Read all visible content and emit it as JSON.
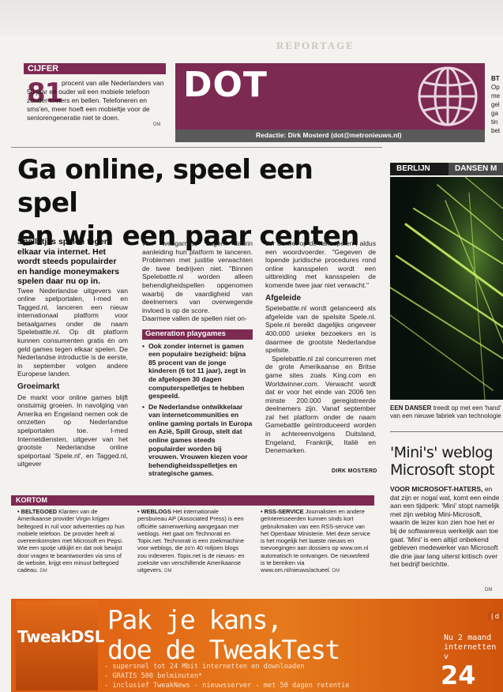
{
  "section_ghost": "REPORTAGE",
  "cijfer": {
    "label": "CIJFER",
    "number": "81",
    "text": "procent van alle Nederlanders van 50 jaar en ouder wil een mobiele telefoon zonder toeters en bellen. Telefoneren en sms'en, meer hoeft een mobieltje voor de seniorengeneratie niet te doen.",
    "sig": "DM"
  },
  "dot": {
    "title": "DOT",
    "redactie": "Redactie: Dirk Mosterd (dot@metronieuws.nl)"
  },
  "side_snippet": {
    "tag": "BT",
    "lines": [
      "Op",
      "me",
      "gel",
      "ga",
      "tin",
      "bet"
    ]
  },
  "article": {
    "headline_line1": "Ga online, speel een spel",
    "headline_line2": "en win een paar centen",
    "intro": "Spelletjes spelen tegen elkaar via internet. Het wordt steeds populairder en handige moneymakers spelen daar nu op in.",
    "p1": "Twee Nederlandse uitgevers van online spelportalen, I-med en Tagged.nl, lanceren een nieuw internationaal platform voor betaalgames onder de naam Spelebattle.nl. Op dit platform kunnen consumenten gratis én om geld games tegen elkaar spelen. De Nederlandse introductie is de eerste, in september volgen andere Europese landen.",
    "sub1": "Groeimarkt",
    "p2": "De markt voor online games blijft onstuimig groeien. In navolging van Amerika en Engeland nemen ook de omzetten op Nederlandse spelportalen toe. I-med Internetdiensten, uitgever van het grootste Nederlandse online spelportaal 'Spele.nl', en Tagged.nl, uitgever",
    "p3": "van webgames, zagen daarin aanleiding hun platform te lanceren. Problemen met justitie verwachten de twee bedrijven niet. \"Binnen Spelebattle.nl worden alleen behendigheidspellen opgenomen waarbij de vaardigheid van deelnemers van overwegende invloed is op de score.",
    "p3b": "Daarmee vallen de spellen niet on-",
    "gen_head": "Generation playgames",
    "gen_1": "Ook zonder internet is gamen een populaire bezigheid: bijna 85 procent van de jonge kinderen (6 tot 11 jaar), zegt in de afgelopen 30 dagen computerspelletjes te hebben gespeeld.",
    "gen_2": "De Nederlandse ontwikkelaar van internetcommunities en online gaming portals in Europa en Azië, Spill Group, stelt dat online games steeds populairder worden bij vrouwen. Vrouwen kiezen voor behendigheidsspelletjes en strategische games.",
    "p4": "der de wet op de kansspelen\", aldus een woordvoerder. \"Gegeven de lopende juridische procedures rond online kansspelen wordt een uitbreiding met kansspelen de komende twee jaar niet verwacht.\"",
    "sub2": "Afgeleide",
    "p5": "Spelebattle.nl wordt gelanceerd als afgeleide van de spelsite Spele.nl. Spele.nl bereikt dagelijks ongeveer 400.000 unieke bezoekers en is daarmee de grootste Nederlandse spelsite.",
    "p6": "Spelebattle.nl zal concurreren met de grote Amerikaanse en Britse game sites zoals King.com en Worldwinner.com. Verwacht wordt dat er voor het einde van 2006 ten minste 200.000 geregistreerde deelnemers zijn. Vanaf september zal het platform onder de naam Gamebattle geïntroduceerd worden in achtereenvolgens Duitsland, Engeland, Frankrijk, Italië en Denemarken.",
    "byline": "DIRK MOSTERD"
  },
  "photo": {
    "label1": "BERLIJN",
    "label2": "DANSEN M",
    "caption_bold": "EEN DANSER",
    "caption": "treedt op met een 'hand' van een nieuwe fabriek van technologie"
  },
  "side_article": {
    "headline": "'Mini's' weblog Microsoft stopt",
    "lead_bold": "VOOR MICROSOFT-HATERS,",
    "text": "en dat zijn er nogal wat, komt een einde aan een tijdperk: 'Mini' stopt namelijk met zijn weblog Mini-Microsoft, waarin de lezer kon zien hoe het er bij de softwarereus werkelijk aan toe gaat. 'Mini' is een altijd onbekend gebleven medewerker van Microsoft die drie jaar lang uiterst kritisch over het bedrijf berichtte.",
    "sig": "DM"
  },
  "kortom": {
    "label": "KORTOM",
    "items": [
      {
        "bold": "• BELTEGOED",
        "text": "Klanten van de Amerikaanse provider Virgin krijgen beltegoed in ruil voor advertenties op hun mobiele telefoon. De provider heeft al overeenkomsten met Microsoft en Pepsi. Wie een spotje uitkijkt en dat ook bewijst door vragen te beantwoorden via sms of de website, krijgt een minuut beltegoed cadeau.",
        "sig": "DM"
      },
      {
        "bold": "• WEBLOGS",
        "text": "Het internationale persbureau AP (Associated Press) is een officiële samenwerking aangegaan met weblogs. Het gaat om Technorati en Topix.net. Technorati is een zoekmachine voor weblogs, die zo'n 40 miljoen blogs zou indexeren. Topix.net is de nieuws- en zoeksite van verschillende Amerikaanse uitgevers.",
        "sig": "DM"
      },
      {
        "bold": "• RSS-SERVICE",
        "text": "Journalisten en andere geïnteresseerden kunnen sinds kort gebruikmaken van een RSS-service van het Openbaar Ministerie. Met deze service is het mogelijk het laatste nieuws en toevoegingen aan dossiers op www.om.nl automatisch te ontvangen. De nieuwsfeed is te bereiken via www.om.nl/nieuws/actueel.",
        "sig": "DM"
      }
    ]
  },
  "ad": {
    "logo": "TweakDSL",
    "headline1": "Pak je kans,",
    "headline2": "doe de TweakTest",
    "bullets": [
      "- supersnel tot 24 Mbit internetten en downloaden",
      "- GRATIS 500 belminuten*",
      "- inclusief TweakNews - nieuwsserver - met 50 dagen retentie"
    ],
    "right1": "Nu 2 maand",
    "right2": "internetten v",
    "big": "24",
    "chip": "| d"
  },
  "colors": {
    "accent": "#7d2a52",
    "ad_orange": "#e06a18"
  }
}
